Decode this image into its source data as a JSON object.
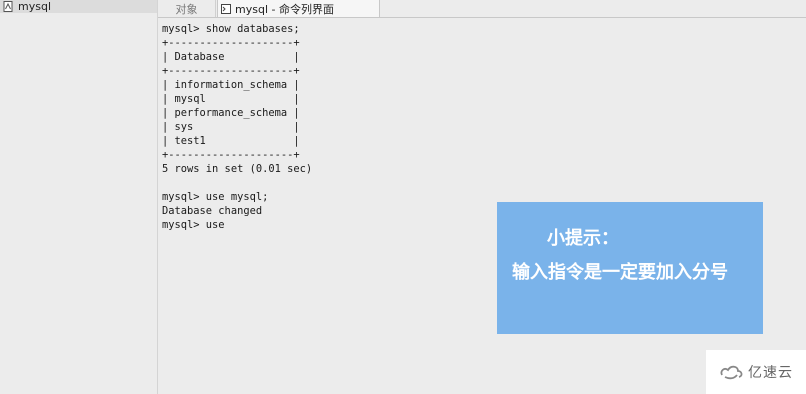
{
  "sidebar": {
    "items": [
      {
        "label": "mysql",
        "icon": "database-icon"
      }
    ]
  },
  "tabs": [
    {
      "label": "对象",
      "active": false
    },
    {
      "label": "mysql - 命令列界面",
      "active": true,
      "icon": "console-icon"
    }
  ],
  "console": {
    "lines": [
      "mysql> show databases;",
      "+--------------------+",
      "| Database           |",
      "+--------------------+",
      "| information_schema |",
      "| mysql              |",
      "| performance_schema |",
      "| sys                |",
      "| test1              |",
      "+--------------------+",
      "5 rows in set (0.01 sec)",
      "",
      "mysql> use mysql;",
      "Database changed",
      "mysql> use"
    ]
  },
  "tip": {
    "title": "小提示：",
    "text": "输入指令是一定要加入分号",
    "background": "#7ab3ea"
  },
  "watermark": {
    "text": "亿速云",
    "icon": "yisu-cloud-logo-icon"
  }
}
